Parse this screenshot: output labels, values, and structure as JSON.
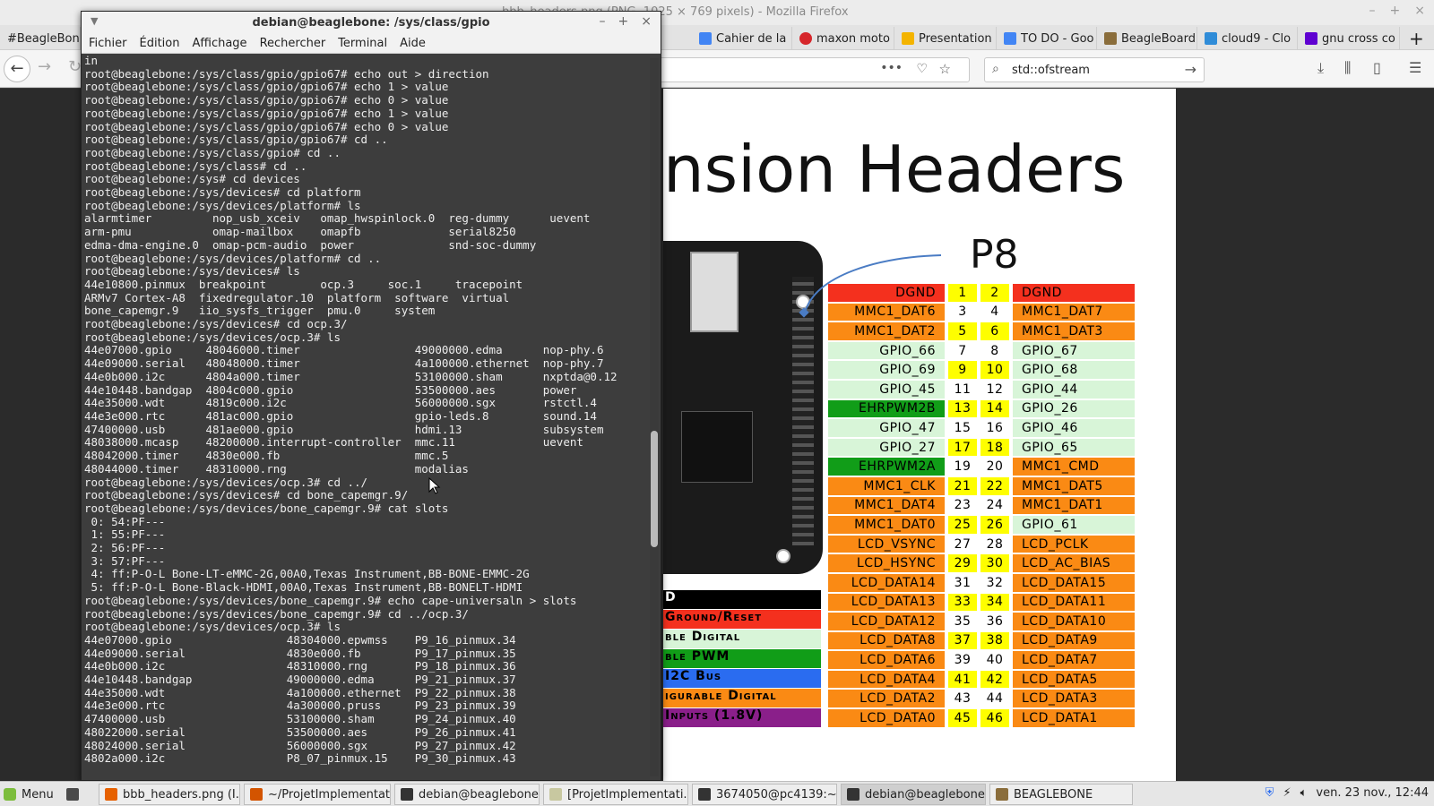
{
  "firefox": {
    "title": "bbb_headers.png (PNG, 1025 × 769 pixels) - Mozilla Firefox",
    "tabs": [
      {
        "label": "#BeagleBone",
        "color": "#888888"
      },
      {
        "label": "Cahier de la",
        "color": "#4285f4"
      },
      {
        "label": "maxon moto",
        "color": "#d6262b"
      },
      {
        "label": "Presentation",
        "color": "#f4b400"
      },
      {
        "label": "TO DO - Goo",
        "color": "#4285f4"
      },
      {
        "label": "BeagleBoard",
        "color": "#8a6d3b"
      },
      {
        "label": "cloud9 - Clo",
        "color": "#2f8cd8"
      },
      {
        "label": "gnu cross co",
        "color": "#5f01d1"
      }
    ],
    "new_tab": "+",
    "search_value": "std::ofstream",
    "url_value": ""
  },
  "image": {
    "title": "nsion Headers",
    "header_label": "P8",
    "pins": [
      {
        "left": "DGND",
        "n1": "1",
        "n2": "2",
        "right": "DGND",
        "lc": "red",
        "rc": "red",
        "y1": true,
        "y2": true
      },
      {
        "left": "MMC1_DAT6",
        "n1": "3",
        "n2": "4",
        "right": "MMC1_DAT7",
        "lc": "orange",
        "rc": "orange",
        "y1": false,
        "y2": false
      },
      {
        "left": "MMC1_DAT2",
        "n1": "5",
        "n2": "6",
        "right": "MMC1_DAT3",
        "lc": "orange",
        "rc": "orange",
        "y1": true,
        "y2": true
      },
      {
        "left": "GPIO_66",
        "n1": "7",
        "n2": "8",
        "right": "GPIO_67",
        "lc": "lgreen",
        "rc": "lgreen",
        "y1": false,
        "y2": false
      },
      {
        "left": "GPIO_69",
        "n1": "9",
        "n2": "10",
        "right": "GPIO_68",
        "lc": "lgreen",
        "rc": "lgreen",
        "y1": true,
        "y2": true
      },
      {
        "left": "GPIO_45",
        "n1": "11",
        "n2": "12",
        "right": "GPIO_44",
        "lc": "lgreen",
        "rc": "lgreen",
        "y1": false,
        "y2": false
      },
      {
        "left": "EHRPWM2B",
        "n1": "13",
        "n2": "14",
        "right": "GPIO_26",
        "lc": "dgreen",
        "rc": "lgreen",
        "y1": true,
        "y2": true
      },
      {
        "left": "GPIO_47",
        "n1": "15",
        "n2": "16",
        "right": "GPIO_46",
        "lc": "lgreen",
        "rc": "lgreen",
        "y1": false,
        "y2": false
      },
      {
        "left": "GPIO_27",
        "n1": "17",
        "n2": "18",
        "right": "GPIO_65",
        "lc": "lgreen",
        "rc": "lgreen",
        "y1": true,
        "y2": true
      },
      {
        "left": "EHRPWM2A",
        "n1": "19",
        "n2": "20",
        "right": "MMC1_CMD",
        "lc": "dgreen",
        "rc": "orange",
        "y1": false,
        "y2": false
      },
      {
        "left": "MMC1_CLK",
        "n1": "21",
        "n2": "22",
        "right": "MMC1_DAT5",
        "lc": "orange",
        "rc": "orange",
        "y1": true,
        "y2": true
      },
      {
        "left": "MMC1_DAT4",
        "n1": "23",
        "n2": "24",
        "right": "MMC1_DAT1",
        "lc": "orange",
        "rc": "orange",
        "y1": false,
        "y2": false
      },
      {
        "left": "MMC1_DAT0",
        "n1": "25",
        "n2": "26",
        "right": "GPIO_61",
        "lc": "orange",
        "rc": "lgreen",
        "y1": true,
        "y2": true
      },
      {
        "left": "LCD_VSYNC",
        "n1": "27",
        "n2": "28",
        "right": "LCD_PCLK",
        "lc": "orange",
        "rc": "orange",
        "y1": false,
        "y2": false
      },
      {
        "left": "LCD_HSYNC",
        "n1": "29",
        "n2": "30",
        "right": "LCD_AC_BIAS",
        "lc": "orange",
        "rc": "orange",
        "y1": true,
        "y2": true
      },
      {
        "left": "LCD_DATA14",
        "n1": "31",
        "n2": "32",
        "right": "LCD_DATA15",
        "lc": "orange",
        "rc": "orange",
        "y1": false,
        "y2": false
      },
      {
        "left": "LCD_DATA13",
        "n1": "33",
        "n2": "34",
        "right": "LCD_DATA11",
        "lc": "orange",
        "rc": "orange",
        "y1": true,
        "y2": true
      },
      {
        "left": "LCD_DATA12",
        "n1": "35",
        "n2": "36",
        "right": "LCD_DATA10",
        "lc": "orange",
        "rc": "orange",
        "y1": false,
        "y2": false
      },
      {
        "left": "LCD_DATA8",
        "n1": "37",
        "n2": "38",
        "right": "LCD_DATA9",
        "lc": "orange",
        "rc": "orange",
        "y1": true,
        "y2": true
      },
      {
        "left": "LCD_DATA6",
        "n1": "39",
        "n2": "40",
        "right": "LCD_DATA7",
        "lc": "orange",
        "rc": "orange",
        "y1": false,
        "y2": false
      },
      {
        "left": "LCD_DATA4",
        "n1": "41",
        "n2": "42",
        "right": "LCD_DATA5",
        "lc": "orange",
        "rc": "orange",
        "y1": true,
        "y2": true
      },
      {
        "left": "LCD_DATA2",
        "n1": "43",
        "n2": "44",
        "right": "LCD_DATA3",
        "lc": "orange",
        "rc": "orange",
        "y1": false,
        "y2": false
      },
      {
        "left": "LCD_DATA0",
        "n1": "45",
        "n2": "46",
        "right": "LCD_DATA1",
        "lc": "orange",
        "rc": "orange",
        "y1": true,
        "y2": true
      }
    ],
    "legend": [
      {
        "text": "D",
        "bg": "#000000",
        "fg": "#ffffff"
      },
      {
        "text": "Ground/Reset",
        "bg": "#f4301e",
        "fg": "#000000"
      },
      {
        "text": "ble Digital",
        "bg": "#d8f5d8",
        "fg": "#000000"
      },
      {
        "text": "ble PWM",
        "bg": "#119d18",
        "fg": "#000000"
      },
      {
        "text": "I2C Bus",
        "bg": "#2a6cf0",
        "fg": "#000000"
      },
      {
        "text": "igurable Digital",
        "bg": "#fa8a14",
        "fg": "#000000"
      },
      {
        "text": "Inputs (1.8V)",
        "bg": "#8a1f8a",
        "fg": "#000000"
      }
    ],
    "colors": {
      "red": "#f4301e",
      "orange": "#fa8a14",
      "lgreen": "#d8f5d8",
      "dgreen": "#119d18",
      "yellow": "#fefe00"
    }
  },
  "terminal": {
    "title": "debian@beaglebone: /sys/class/gpio",
    "menu": [
      "Fichier",
      "Édition",
      "Affichage",
      "Rechercher",
      "Terminal",
      "Aide"
    ],
    "lines": [
      "in",
      "root@beaglebone:/sys/class/gpio/gpio67# echo out > direction",
      "root@beaglebone:/sys/class/gpio/gpio67# echo 1 > value",
      "root@beaglebone:/sys/class/gpio/gpio67# echo 0 > value",
      "root@beaglebone:/sys/class/gpio/gpio67# echo 1 > value",
      "root@beaglebone:/sys/class/gpio/gpio67# echo 0 > value",
      "root@beaglebone:/sys/class/gpio/gpio67# cd ..",
      "root@beaglebone:/sys/class/gpio# cd ..",
      "root@beaglebone:/sys/class# cd ..",
      "root@beaglebone:/sys# cd devices",
      "root@beaglebone:/sys/devices# cd platform",
      "root@beaglebone:/sys/devices/platform# ls",
      "alarmtimer         nop_usb_xceiv   omap_hwspinlock.0  reg-dummy      uevent",
      "arm-pmu            omap-mailbox    omapfb             serial8250",
      "edma-dma-engine.0  omap-pcm-audio  power              snd-soc-dummy",
      "root@beaglebone:/sys/devices/platform# cd ..",
      "root@beaglebone:/sys/devices# ls",
      "44e10800.pinmux  breakpoint        ocp.3     soc.1     tracepoint",
      "ARMv7 Cortex-A8  fixedregulator.10  platform  software  virtual",
      "bone_capemgr.9   iio_sysfs_trigger  pmu.0     system",
      "root@beaglebone:/sys/devices# cd ocp.3/",
      "root@beaglebone:/sys/devices/ocp.3# ls",
      "44e07000.gpio     48046000.timer                 49000000.edma      nop-phy.6",
      "44e09000.serial   48048000.timer                 4a100000.ethernet  nop-phy.7",
      "44e0b000.i2c      4804a000.timer                 53100000.sham      nxptda@0.12",
      "44e10448.bandgap  4804c000.gpio                  53500000.aes       power",
      "44e35000.wdt      4819c000.i2c                   56000000.sgx       rstctl.4",
      "44e3e000.rtc      481ac000.gpio                  gpio-leds.8        sound.14",
      "47400000.usb      481ae000.gpio                  hdmi.13            subsystem",
      "48038000.mcasp    48200000.interrupt-controller  mmc.11             uevent",
      "48042000.timer    4830e000.fb                    mmc.5",
      "48044000.timer    48310000.rng                   modalias",
      "root@beaglebone:/sys/devices/ocp.3# cd ../",
      "root@beaglebone:/sys/devices# cd bone_capemgr.9/",
      "root@beaglebone:/sys/devices/bone_capemgr.9# cat slots",
      " 0: 54:PF---",
      " 1: 55:PF---",
      " 2: 56:PF---",
      " 3: 57:PF---",
      " 4: ff:P-O-L Bone-LT-eMMC-2G,00A0,Texas Instrument,BB-BONE-EMMC-2G",
      " 5: ff:P-O-L Bone-Black-HDMI,00A0,Texas Instrument,BB-BONELT-HDMI",
      "root@beaglebone:/sys/devices/bone_capemgr.9# echo cape-universaln > slots",
      "root@beaglebone:/sys/devices/bone_capemgr.9# cd ../ocp.3/",
      "root@beaglebone:/sys/devices/ocp.3# ls",
      "44e07000.gpio                 48304000.epwmss    P9_16_pinmux.34",
      "44e09000.serial               4830e000.fb        P9_17_pinmux.35",
      "44e0b000.i2c                  48310000.rng       P9_18_pinmux.36",
      "44e10448.bandgap              49000000.edma      P9_21_pinmux.37",
      "44e35000.wdt                  4a100000.ethernet  P9_22_pinmux.38",
      "44e3e000.rtc                  4a300000.pruss     P9_23_pinmux.39",
      "47400000.usb                  53100000.sham      P9_24_pinmux.40",
      "48022000.serial               53500000.aes       P9_26_pinmux.41",
      "48024000.serial               56000000.sgx       P9_27_pinmux.42",
      "4802a000.i2c                  P8_07_pinmux.15    P9_30_pinmux.43"
    ]
  },
  "taskbar": {
    "menu_label": "Menu",
    "items": [
      {
        "label": "bbb_headers.png (I...",
        "color": "#e66000",
        "active": false
      },
      {
        "label": "~/ProjetImplementat...",
        "color": "#d35400",
        "active": false
      },
      {
        "label": "debian@beaglebone...",
        "color": "#333333",
        "active": false
      },
      {
        "label": "[ProjetImplementati...",
        "color": "#c8c8a0",
        "active": false
      },
      {
        "label": "3674050@pc4139:~",
        "color": "#333333",
        "active": false
      },
      {
        "label": "debian@beaglebone...",
        "color": "#333333",
        "active": true
      },
      {
        "label": "BEAGLEBONE",
        "color": "#8a6d3b",
        "active": false
      }
    ],
    "clock": "ven. 23 nov., 12:44"
  }
}
